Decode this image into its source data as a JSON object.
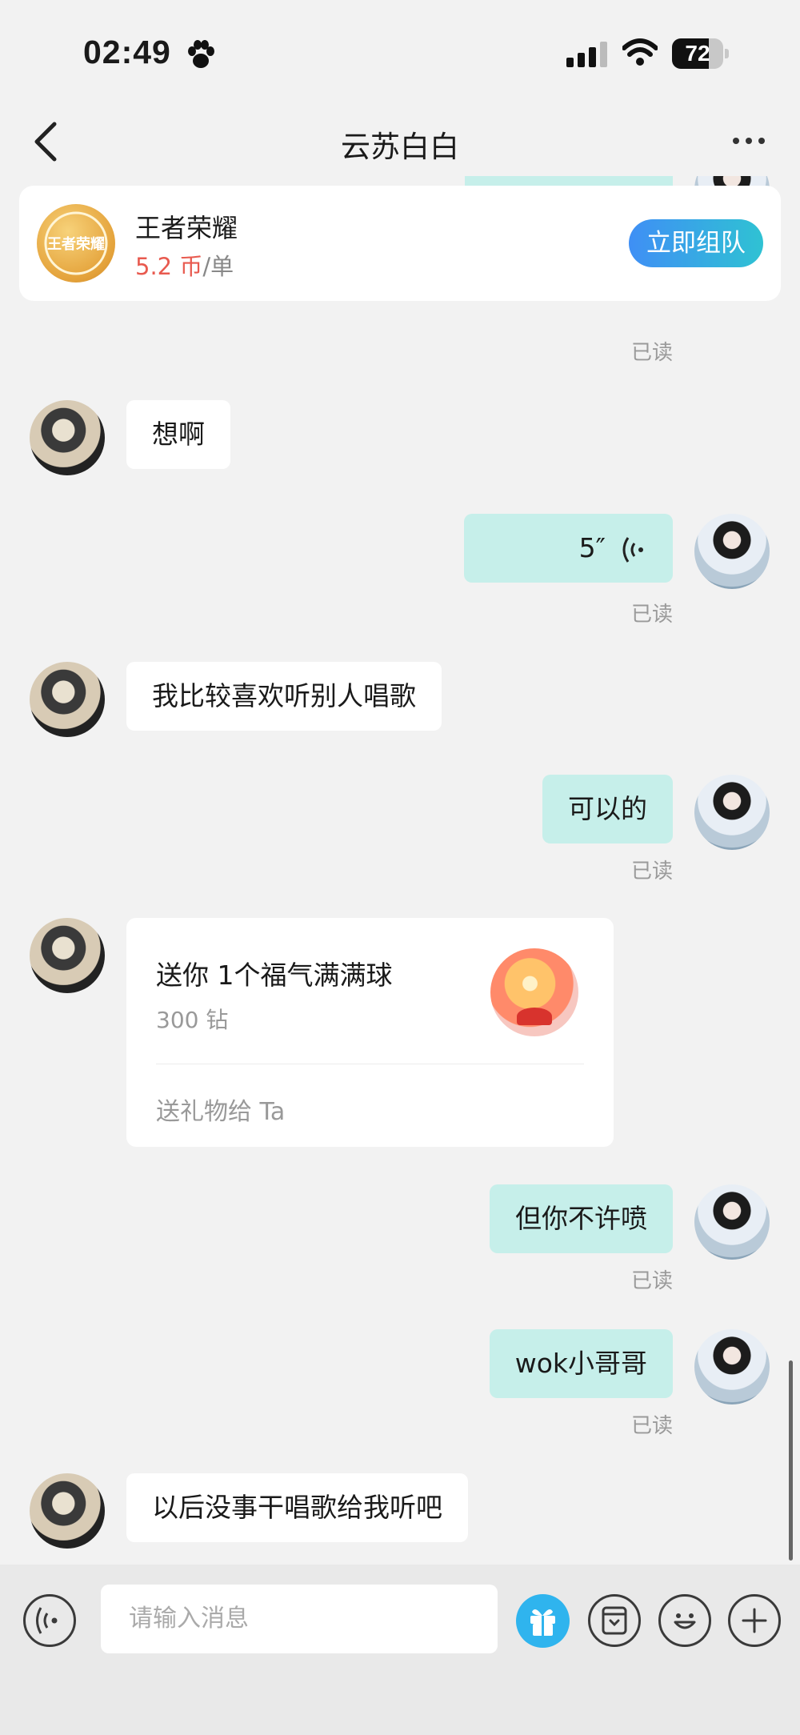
{
  "status_bar": {
    "time": "02:49",
    "battery_level": "72",
    "battery_fraction": 0.72
  },
  "nav": {
    "title": "云苏白白"
  },
  "game_card": {
    "name": "王者荣耀",
    "price_value": "5.2 币",
    "price_unit": "/单",
    "button_label": "立即组队",
    "logo_text": "王者荣耀"
  },
  "messages": [
    {
      "side": "out",
      "type": "text",
      "text": "",
      "read": "已读"
    },
    {
      "side": "in",
      "type": "text",
      "text": "想啊"
    },
    {
      "side": "out",
      "type": "voice",
      "duration": "5″",
      "read": "已读"
    },
    {
      "side": "in",
      "type": "text",
      "text": "我比较喜欢听别人唱歌"
    },
    {
      "side": "out",
      "type": "text",
      "text": "可以的",
      "read": "已读"
    },
    {
      "side": "in",
      "type": "gift",
      "title": "送你 1个福气满满球",
      "price": "300 钻",
      "action": "送礼物给 Ta"
    },
    {
      "side": "out",
      "type": "text",
      "text": "但你不许喷",
      "read": "已读"
    },
    {
      "side": "out",
      "type": "text",
      "text": "wok小哥哥",
      "read": "已读"
    },
    {
      "side": "in",
      "type": "text",
      "text": "以后没事干唱歌给我听吧"
    }
  ],
  "input_bar": {
    "placeholder": "请输入消息"
  },
  "icons": {
    "paw": "paw-icon",
    "signal": "signal-icon",
    "wifi": "wifi-icon",
    "battery": "battery-icon",
    "back": "back-chevron-icon",
    "more": "more-dots-icon",
    "voice": "voice-icon",
    "gift": "gift-icon",
    "sticker": "sticker-icon",
    "emoji": "emoji-icon",
    "plus": "plus-icon"
  },
  "colors": {
    "outgoing_bubble": "#c6efea",
    "accent": "#2fb4ee",
    "price": "#e85a4f"
  }
}
